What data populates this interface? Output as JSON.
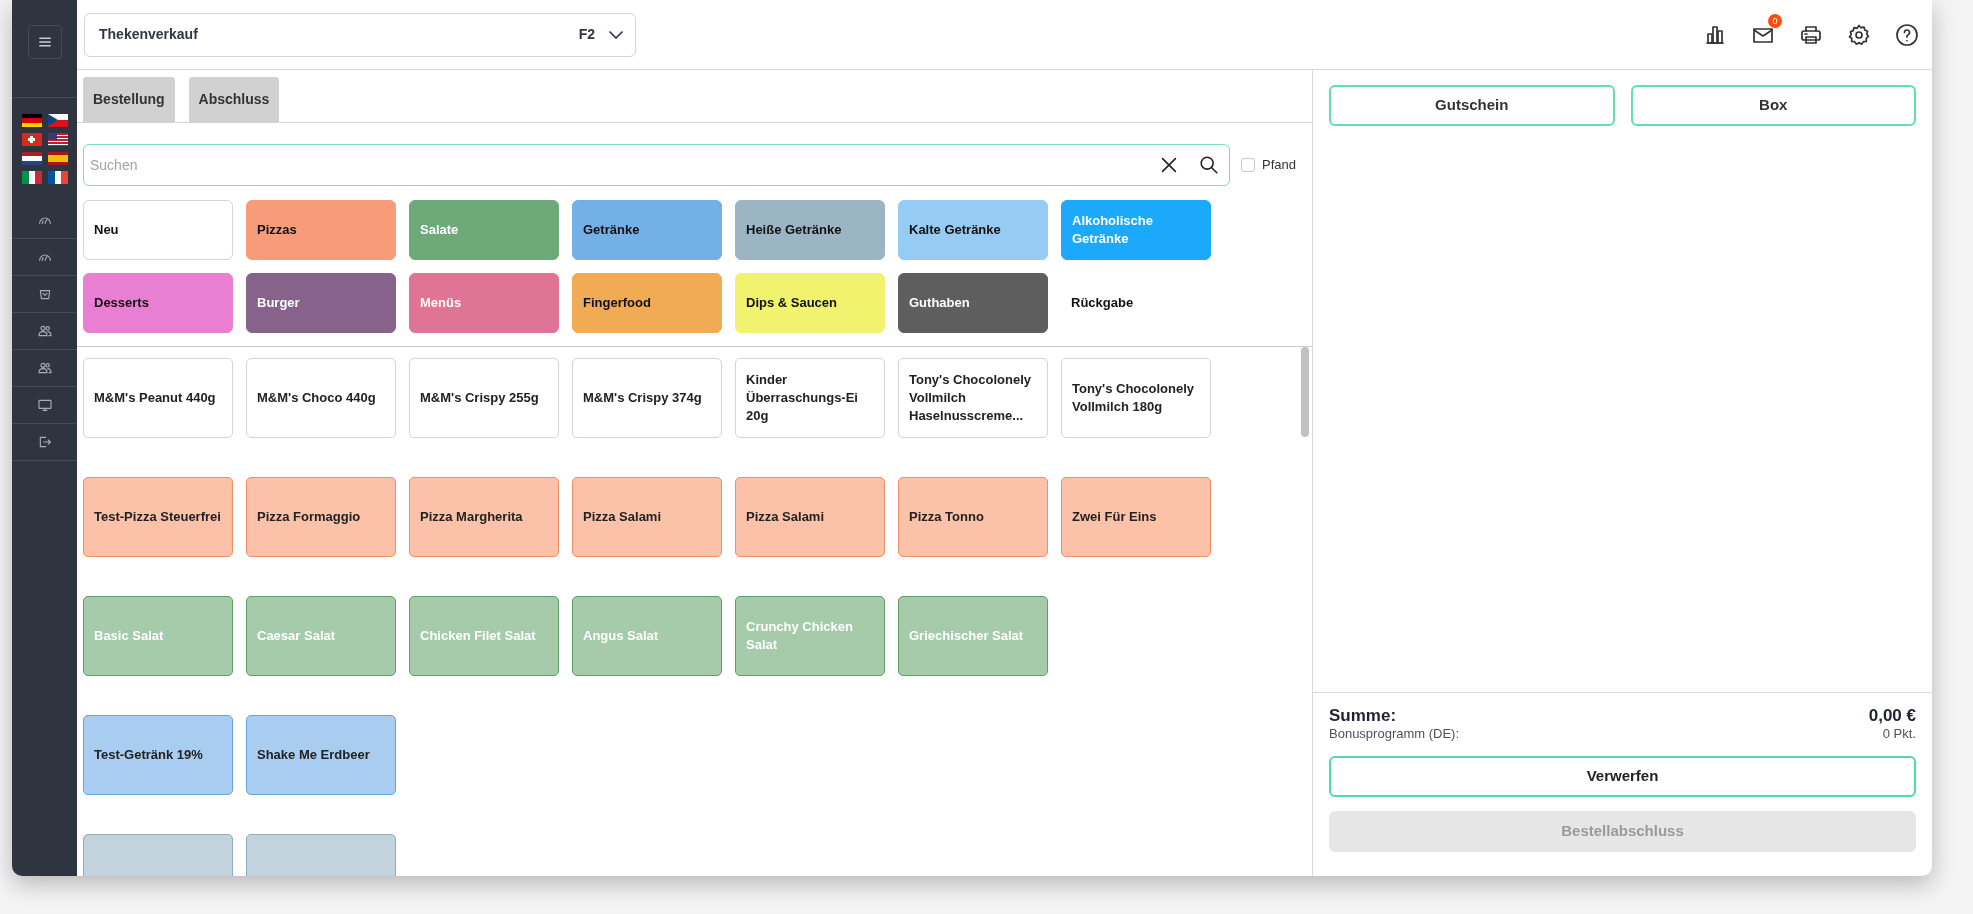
{
  "sidebar": {
    "languages": [
      {
        "kind": "de"
      },
      {
        "kind": "cz"
      },
      {
        "kind": "ch"
      },
      {
        "kind": "us"
      },
      {
        "kind": "nl"
      },
      {
        "kind": "es"
      },
      {
        "kind": "it"
      },
      {
        "kind": "fr"
      }
    ],
    "nav_items": [
      {
        "kind": "gauge"
      },
      {
        "kind": "gauge"
      },
      {
        "kind": "basket"
      },
      {
        "kind": "users"
      },
      {
        "kind": "users"
      },
      {
        "kind": "monitor"
      },
      {
        "kind": "logout"
      }
    ]
  },
  "header": {
    "mode_select": {
      "label": "Thekenverkauf",
      "shortcut": "F2"
    },
    "mail_badge": "0"
  },
  "tabs": [
    {
      "label": "Bestellung"
    },
    {
      "label": "Abschluss"
    }
  ],
  "search": {
    "placeholder": "Suchen",
    "deposit_label": "Pfand",
    "deposit_checked": false
  },
  "categories": [
    {
      "label": "Neu",
      "color": "#ffffff",
      "light_label": false
    },
    {
      "label": "Pizzas",
      "color": "#f79c79",
      "light_label": false
    },
    {
      "label": "Salate",
      "color": "#6da979",
      "light_label": true
    },
    {
      "label": "Getränke",
      "color": "#74b0e8",
      "light_label": false
    },
    {
      "label": "Heiße Getränke",
      "color": "#9cb5c5",
      "light_label": false
    },
    {
      "label": "Kalte Getränke",
      "color": "#96ccf3",
      "light_label": false
    },
    {
      "label": "Alkoholische Getränke",
      "color": "#1da9fb",
      "light_label": true
    },
    {
      "label": "Desserts",
      "color": "#e87fd3",
      "light_label": false
    },
    {
      "label": "Burger",
      "color": "#87638c",
      "light_label": true
    },
    {
      "label": "Menüs",
      "color": "#df7496",
      "light_label": true
    },
    {
      "label": "Fingerfood",
      "color": "#f2ab55",
      "light_label": false
    },
    {
      "label": "Dips & Saucen",
      "color": "#f1f26d",
      "light_label": false
    },
    {
      "label": "Guthaben",
      "color": "#5e5e5e",
      "light_label": true
    },
    {
      "label": "Rückgabe",
      "light_label": false
    }
  ],
  "product_groups": [
    {
      "color": "#ffffff",
      "light_label": false,
      "items": [
        "M&M's Peanut 440g",
        "M&M's Choco 440g",
        "M&M's Crispy 255g",
        "M&M's Crispy 374g",
        "Kinder Überraschungs-Ei 20g",
        "Tony's Chocolonely Vollmilch Haselnusscreme...",
        "Tony's Chocolonely Vollmilch 180g"
      ]
    },
    {
      "color": "#fbc1a9",
      "light_label": false,
      "items": [
        "Test-Pizza Steuerfrei",
        "Pizza Formaggio",
        "Pizza Margherita",
        "Pizza Salami",
        "Pizza Salami",
        "Pizza Tonno",
        "Zwei Für Eins"
      ]
    },
    {
      "color": "#a6cbab",
      "light_label": true,
      "items": [
        "Basic Salat",
        "Caesar Salat",
        "Chicken Filet Salat",
        "Angus Salat",
        "Crunchy Chicken Salat",
        "Griechischer Salat"
      ]
    },
    {
      "color": "#a9cdf1",
      "light_label": false,
      "items": [
        "Test-Getränk 19%",
        "Shake Me Erdbeer"
      ]
    },
    {
      "color": "#c2d3de",
      "items": [
        {
          "kind": "cut_off"
        },
        {
          "kind": "cut_off"
        }
      ]
    }
  ],
  "order_panel": {
    "buttons": [
      "Gutschein",
      "Box"
    ],
    "total_label": "Summe:",
    "total_value": "0,00 €",
    "bonus_label": "Bonusprogramm (DE):",
    "bonus_value": "0 Pkt.",
    "discard_button": "Verwerfen",
    "checkout_button": {
      "label": "Bestellabschluss",
      "disabled": true
    }
  }
}
